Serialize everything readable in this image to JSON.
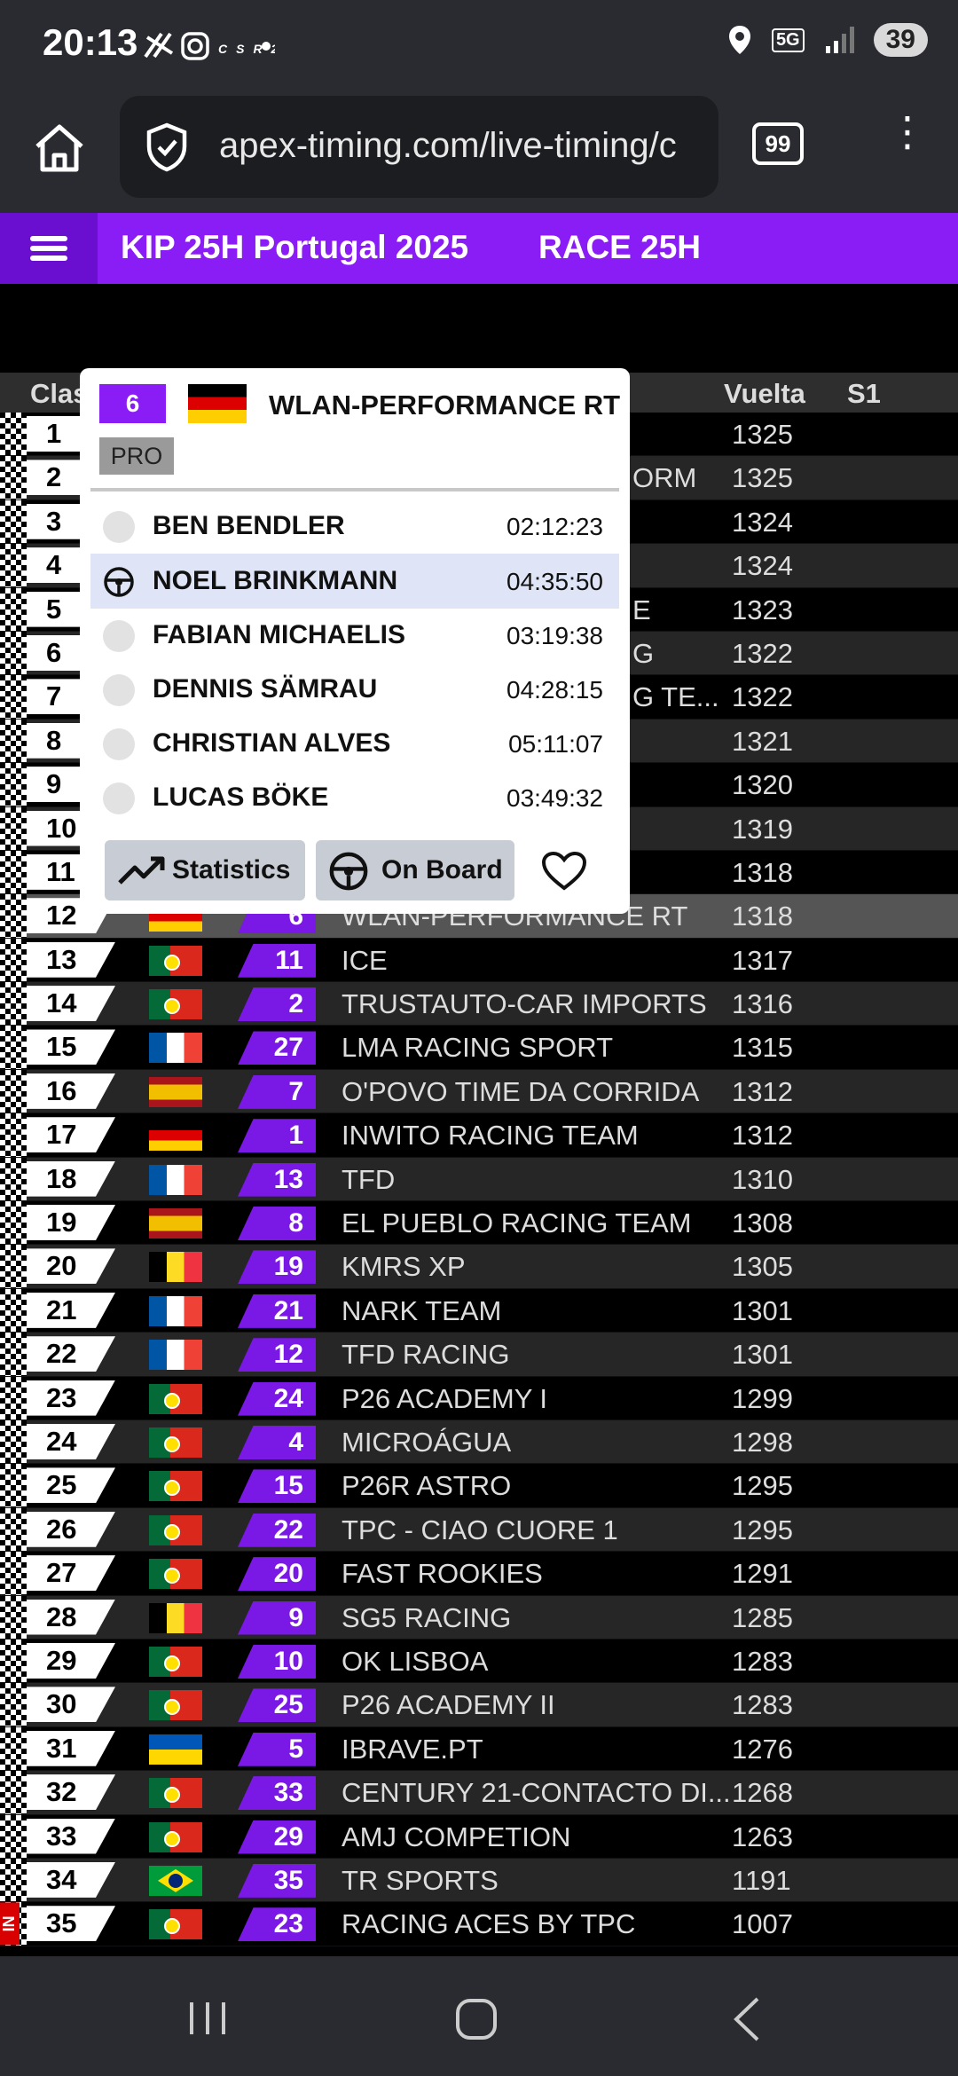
{
  "status_bar": {
    "time": "20:13",
    "battery": "39",
    "network": "5G"
  },
  "browser": {
    "url": "apex-timing.com/live-timing/c",
    "tab_count": "99"
  },
  "header": {
    "title": "KIP 25H Portugal 2025",
    "race": "RACE 25H"
  },
  "table_header": {
    "clas": "Clas",
    "vuelta": "Vuelta",
    "s1": "S1"
  },
  "popup": {
    "car_number": "6",
    "team": "WLAN-PERFORMANCE RT",
    "class": "PRO",
    "drivers": [
      {
        "name": "BEN BENDLER",
        "time": "02:12:23"
      },
      {
        "name": "NOEL BRINKMANN",
        "time": "04:35:50"
      },
      {
        "name": "FABIAN MICHAELIS",
        "time": "03:19:38"
      },
      {
        "name": "DENNIS SÄMRAU",
        "time": "04:28:15"
      },
      {
        "name": "CHRISTIAN ALVES",
        "time": "05:11:07"
      },
      {
        "name": "LUCAS BÖKE",
        "time": "03:49:32"
      }
    ],
    "statistics_label": "Statistics",
    "onboard_label": "On Board"
  },
  "partial_teams": {
    "r2": "ORM",
    "r5": "E",
    "r6": "G",
    "r7": "G TE..."
  },
  "rows": [
    {
      "pos": "1",
      "lap": "1325"
    },
    {
      "pos": "2",
      "lap": "1325"
    },
    {
      "pos": "3",
      "lap": "1324"
    },
    {
      "pos": "4",
      "lap": "1324"
    },
    {
      "pos": "5",
      "lap": "1323"
    },
    {
      "pos": "6",
      "lap": "1322"
    },
    {
      "pos": "7",
      "lap": "1322"
    },
    {
      "pos": "8",
      "lap": "1321"
    },
    {
      "pos": "9",
      "lap": "1320"
    },
    {
      "pos": "10",
      "lap": "1319"
    },
    {
      "pos": "11",
      "lap": "1318"
    },
    {
      "pos": "12",
      "flag": "de",
      "num": "6",
      "team": "WLAN-PERFORMANCE RT",
      "lap": "1318"
    },
    {
      "pos": "13",
      "flag": "pt",
      "num": "11",
      "team": "ICE",
      "lap": "1317"
    },
    {
      "pos": "14",
      "flag": "pt",
      "num": "2",
      "team": "TRUSTAUTO-CAR IMPORTS",
      "lap": "1316"
    },
    {
      "pos": "15",
      "flag": "fr",
      "num": "27",
      "team": "LMA RACING SPORT",
      "lap": "1315"
    },
    {
      "pos": "16",
      "flag": "es",
      "num": "7",
      "team": "O'POVO TIME DA CORRIDA",
      "lap": "1312"
    },
    {
      "pos": "17",
      "flag": "de",
      "num": "1",
      "team": "INWITO RACING TEAM",
      "lap": "1312"
    },
    {
      "pos": "18",
      "flag": "fr",
      "num": "13",
      "team": "TFD",
      "lap": "1310"
    },
    {
      "pos": "19",
      "flag": "es",
      "num": "8",
      "team": "EL PUEBLO RACING TEAM",
      "lap": "1308"
    },
    {
      "pos": "20",
      "flag": "be",
      "num": "19",
      "team": "KMRS XP",
      "lap": "1305"
    },
    {
      "pos": "21",
      "flag": "fr",
      "num": "21",
      "team": "NARK TEAM",
      "lap": "1301"
    },
    {
      "pos": "22",
      "flag": "fr",
      "num": "12",
      "team": "TFD RACING",
      "lap": "1301"
    },
    {
      "pos": "23",
      "flag": "pt",
      "num": "24",
      "team": "P26 ACADEMY I",
      "lap": "1299"
    },
    {
      "pos": "24",
      "flag": "pt",
      "num": "4",
      "team": "MICROÁGUA",
      "lap": "1298"
    },
    {
      "pos": "25",
      "flag": "pt",
      "num": "15",
      "team": "P26R ASTRO",
      "lap": "1295"
    },
    {
      "pos": "26",
      "flag": "pt",
      "num": "22",
      "team": "TPC - CIAO CUORE 1",
      "lap": "1295"
    },
    {
      "pos": "27",
      "flag": "pt",
      "num": "20",
      "team": "FAST ROOKIES",
      "lap": "1291"
    },
    {
      "pos": "28",
      "flag": "be",
      "num": "9",
      "team": "SG5 RACING",
      "lap": "1285"
    },
    {
      "pos": "29",
      "flag": "pt",
      "num": "10",
      "team": "OK LISBOA",
      "lap": "1283"
    },
    {
      "pos": "30",
      "flag": "pt",
      "num": "25",
      "team": "P26 ACADEMY II",
      "lap": "1283"
    },
    {
      "pos": "31",
      "flag": "ua",
      "num": "5",
      "team": "IBRAVE.PT",
      "lap": "1276"
    },
    {
      "pos": "32",
      "flag": "pt",
      "num": "33",
      "team": "CENTURY 21-CONTACTO DI...",
      "lap": "1268"
    },
    {
      "pos": "33",
      "flag": "pt",
      "num": "29",
      "team": "AMJ COMPETION",
      "lap": "1263"
    },
    {
      "pos": "34",
      "flag": "br",
      "num": "35",
      "team": "TR SPORTS",
      "lap": "1191"
    },
    {
      "pos": "35",
      "flag": "pt",
      "num": "23",
      "team": "RACING ACES BY TPC",
      "lap": "1007",
      "pit": "IN"
    }
  ]
}
